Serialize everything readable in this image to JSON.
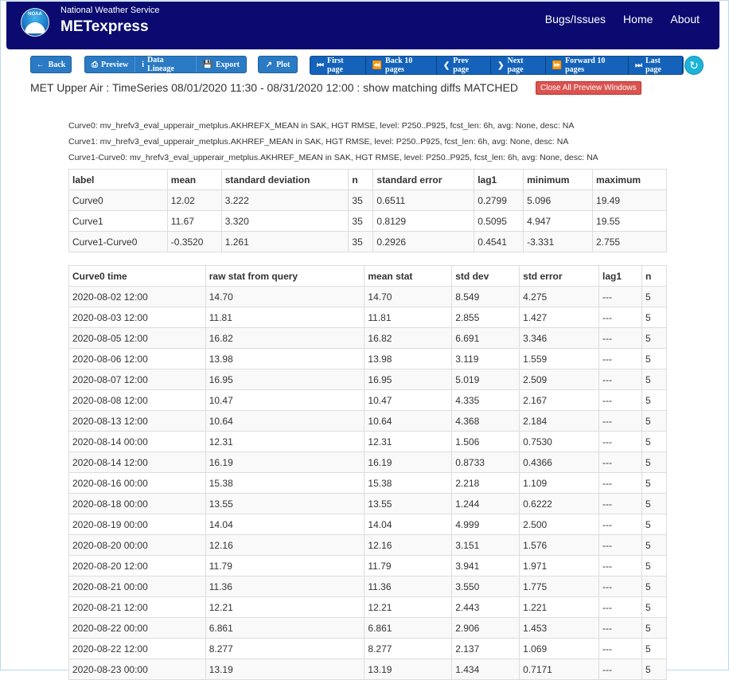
{
  "navbar": {
    "logo_text": "NOAA",
    "subtitle": "National Weather Service",
    "title": "METexpress",
    "links": [
      "Bugs/Issues",
      "Home",
      "About"
    ]
  },
  "toolbar": {
    "back": "Back",
    "preview": "Preview",
    "data_lineage": "Data Lineage",
    "export": "Export",
    "plot": "Plot",
    "first_page": "First page",
    "back_10": "Back 10 pages",
    "prev_page": "Prev page",
    "next_page": "Next page",
    "forward_10": "Forward 10 pages",
    "last_page": "Last page"
  },
  "header": {
    "title": "MET Upper Air : TimeSeries 08/01/2020 11:30 - 08/31/2020 12:00 : show matching diffs MATCHED",
    "close_all": "Close All Preview Windows"
  },
  "curves": [
    "Curve0: mv_hrefv3_eval_upperair_metplus.AKHREFX_MEAN in SAK, HGT RMSE, level: P250..P925, fcst_len: 6h, avg: None, desc: NA",
    "Curve1: mv_hrefv3_eval_upperair_metplus.AKHREF_MEAN in SAK, HGT RMSE, level: P250..P925, fcst_len: 6h, avg: None, desc: NA",
    "Curve1-Curve0: mv_hrefv3_eval_upperair_metplus.AKHREF_MEAN in SAK, HGT RMSE, level: P250..P925, fcst_len: 6h, avg: None, desc: NA"
  ],
  "summary": {
    "headers": [
      "label",
      "mean",
      "standard deviation",
      "n",
      "standard error",
      "lag1",
      "minimum",
      "maximum"
    ],
    "rows": [
      [
        "Curve0",
        "12.02",
        "3.222",
        "35",
        "0.6511",
        "0.2799",
        "5.096",
        "19.49"
      ],
      [
        "Curve1",
        "11.67",
        "3.320",
        "35",
        "0.8129",
        "0.5095",
        "4.947",
        "19.55"
      ],
      [
        "Curve1-Curve0",
        "-0.3520",
        "1.261",
        "35",
        "0.2926",
        "0.4541",
        "-3.331",
        "2.755"
      ]
    ]
  },
  "detail": {
    "headers": [
      "Curve0 time",
      "raw stat from query",
      "mean stat",
      "std dev",
      "std error",
      "lag1",
      "n"
    ],
    "rows": [
      [
        "2020-08-02 12:00",
        "14.70",
        "14.70",
        "8.549",
        "4.275",
        "---",
        "5"
      ],
      [
        "2020-08-03 12:00",
        "11.81",
        "11.81",
        "2.855",
        "1.427",
        "---",
        "5"
      ],
      [
        "2020-08-05 12:00",
        "16.82",
        "16.82",
        "6.691",
        "3.346",
        "---",
        "5"
      ],
      [
        "2020-08-06 12:00",
        "13.98",
        "13.98",
        "3.119",
        "1.559",
        "---",
        "5"
      ],
      [
        "2020-08-07 12:00",
        "16.95",
        "16.95",
        "5.019",
        "2.509",
        "---",
        "5"
      ],
      [
        "2020-08-08 12:00",
        "10.47",
        "10.47",
        "4.335",
        "2.167",
        "---",
        "5"
      ],
      [
        "2020-08-13 12:00",
        "10.64",
        "10.64",
        "4.368",
        "2.184",
        "---",
        "5"
      ],
      [
        "2020-08-14 00:00",
        "12.31",
        "12.31",
        "1.506",
        "0.7530",
        "---",
        "5"
      ],
      [
        "2020-08-14 12:00",
        "16.19",
        "16.19",
        "0.8733",
        "0.4366",
        "---",
        "5"
      ],
      [
        "2020-08-16 00:00",
        "15.38",
        "15.38",
        "2.218",
        "1.109",
        "---",
        "5"
      ],
      [
        "2020-08-18 00:00",
        "13.55",
        "13.55",
        "1.244",
        "0.6222",
        "---",
        "5"
      ],
      [
        "2020-08-19 00:00",
        "14.04",
        "14.04",
        "4.999",
        "2.500",
        "---",
        "5"
      ],
      [
        "2020-08-20 00:00",
        "12.16",
        "12.16",
        "3.151",
        "1.576",
        "---",
        "5"
      ],
      [
        "2020-08-20 12:00",
        "11.79",
        "11.79",
        "3.941",
        "1.971",
        "---",
        "5"
      ],
      [
        "2020-08-21 00:00",
        "11.36",
        "11.36",
        "3.550",
        "1.775",
        "---",
        "5"
      ],
      [
        "2020-08-21 12:00",
        "12.21",
        "12.21",
        "2.443",
        "1.221",
        "---",
        "5"
      ],
      [
        "2020-08-22 00:00",
        "6.861",
        "6.861",
        "2.906",
        "1.453",
        "---",
        "5"
      ],
      [
        "2020-08-22 12:00",
        "8.277",
        "8.277",
        "2.137",
        "1.069",
        "---",
        "5"
      ],
      [
        "2020-08-23 00:00",
        "13.19",
        "13.19",
        "1.434",
        "0.7171",
        "---",
        "5"
      ]
    ]
  }
}
